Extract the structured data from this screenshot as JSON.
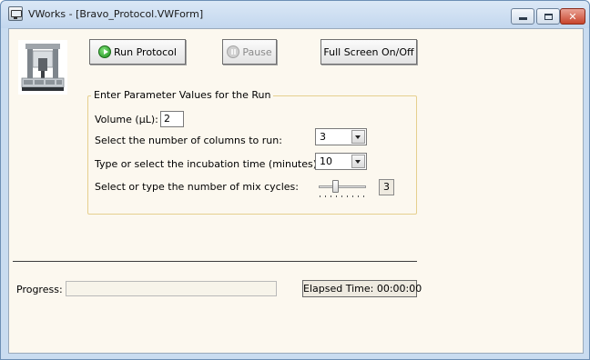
{
  "window": {
    "title": "VWorks - [Bravo_Protocol.VWForm]",
    "close_glyph": "✕"
  },
  "toolbar": {
    "run_label": "Run Protocol",
    "pause_label": "Pause",
    "fullscreen_label": "Full Screen On/Off"
  },
  "params": {
    "group_title": "Enter Parameter Values for the Run",
    "volume_label": "Volume (µL):",
    "volume_value": "2",
    "columns_label": "Select the number of columns to run:",
    "columns_value": "3",
    "incubation_label": "Type or select the incubation time (minutes):",
    "incubation_value": "10",
    "mix_label": "Select or type the number of mix cycles:",
    "mix_value": "3",
    "mix_slider_fraction": 0.33
  },
  "status": {
    "progress_label": "Progress:",
    "progress_fraction": 0,
    "elapsed_label": "Elapsed Time: 00:00:00"
  },
  "icons": {
    "app": "vworks-app-icon",
    "robot": "bravo-robot-image",
    "run": "play-icon",
    "pause": "pause-icon"
  }
}
